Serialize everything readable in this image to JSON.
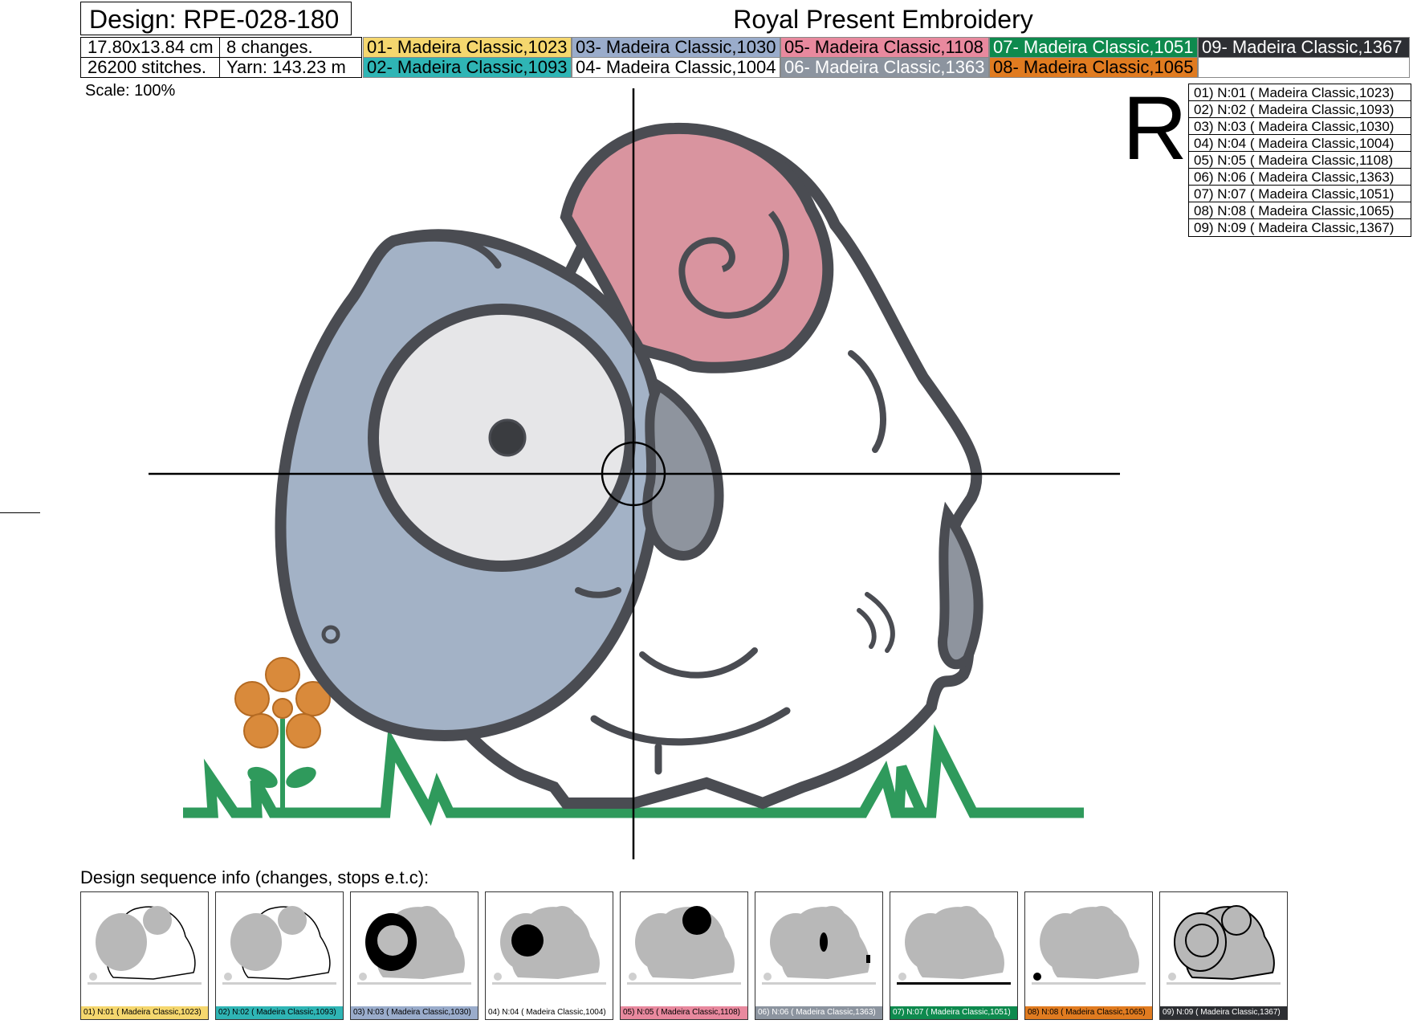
{
  "header": {
    "design_label": "Design: RPE-028-180",
    "company": "Royal Present Embroidery",
    "size": "17.80x13.84 cm",
    "changes": "8 changes.",
    "stitches": "26200 stitches.",
    "yarn": "Yarn: 143.23 m"
  },
  "threads": [
    {
      "label": "01- Madeira Classic,1023",
      "color": "#f5d76e",
      "text_color": "#000000"
    },
    {
      "label": "03- Madeira Classic,1030",
      "color": "#9aaccb",
      "text_color": "#000000"
    },
    {
      "label": "05- Madeira Classic,1108",
      "color": "#e8899e",
      "text_color": "#000000"
    },
    {
      "label": "07- Madeira Classic,1051",
      "color": "#0e8a4e",
      "text_color": "#ffffff"
    },
    {
      "label": "09- Madeira Classic,1367",
      "color": "#2d2f33",
      "text_color": "#ffffff"
    },
    {
      "label": "02- Madeira Classic,1093",
      "color": "#2fb5b5",
      "text_color": "#000000"
    },
    {
      "label": "04- Madeira Classic,1004",
      "color": "#ffffff",
      "text_color": "#000000"
    },
    {
      "label": "06- Madeira Classic,1363",
      "color": "#8c949f",
      "text_color": "#ffffff"
    },
    {
      "label": "08- Madeira Classic,1065",
      "color": "#e07b20",
      "text_color": "#000000"
    }
  ],
  "scale_label": "Scale: 100%",
  "legend_letter": "R",
  "legend": [
    "01) N:01 ( Madeira Classic,1023)",
    "02) N:02 ( Madeira Classic,1093)",
    "03) N:03 ( Madeira Classic,1030)",
    "04) N:04 ( Madeira Classic,1004)",
    "05) N:05 ( Madeira Classic,1108)",
    "06) N:06 ( Madeira Classic,1363)",
    "07) N:07 ( Madeira Classic,1051)",
    "08) N:08 ( Madeira Classic,1065)",
    "09) N:09 ( Madeira Classic,1367)"
  ],
  "sequence_title": "Design sequence info (changes, stops e.t.c):",
  "sequence": [
    {
      "label": "01) N:01 ( Madeira Classic,1023)",
      "color": "#f5d76e",
      "text_color": "#000000",
      "highlight": "white-body"
    },
    {
      "label": "02) N:02 ( Madeira Classic,1093)",
      "color": "#2fb5b5",
      "text_color": "#000000",
      "highlight": "white-body"
    },
    {
      "label": "03) N:03 ( Madeira Classic,1030)",
      "color": "#9aaccb",
      "text_color": "#000000",
      "highlight": "face"
    },
    {
      "label": "04) N:04 ( Madeira Classic,1004)",
      "color": "#ffffff",
      "text_color": "#000000",
      "highlight": "eye"
    },
    {
      "label": "05) N:05 ( Madeira Classic,1108)",
      "color": "#e8899e",
      "text_color": "#000000",
      "highlight": "horn"
    },
    {
      "label": "06) N:06 ( Madeira Classic,1363)",
      "color": "#8c949f",
      "text_color": "#ffffff",
      "highlight": "ears"
    },
    {
      "label": "07) N:07 ( Madeira Classic,1051)",
      "color": "#0e8a4e",
      "text_color": "#ffffff",
      "highlight": "grass"
    },
    {
      "label": "08) N:08 ( Madeira Classic,1065)",
      "color": "#e07b20",
      "text_color": "#000000",
      "highlight": "flower"
    },
    {
      "label": "09) N:09 ( Madeira Classic,1367)",
      "color": "#2d2f33",
      "text_color": "#ffffff",
      "highlight": "outline"
    }
  ],
  "colors": {
    "outline": "#4a4c52",
    "face": "#a3b2c6",
    "eye_white": "#e6e6e8",
    "horn": "#d9949f",
    "ear": "#8e949e",
    "grass": "#2f9a5c",
    "flower": "#d98a3b",
    "preview_gray": "#b8b8b8"
  }
}
